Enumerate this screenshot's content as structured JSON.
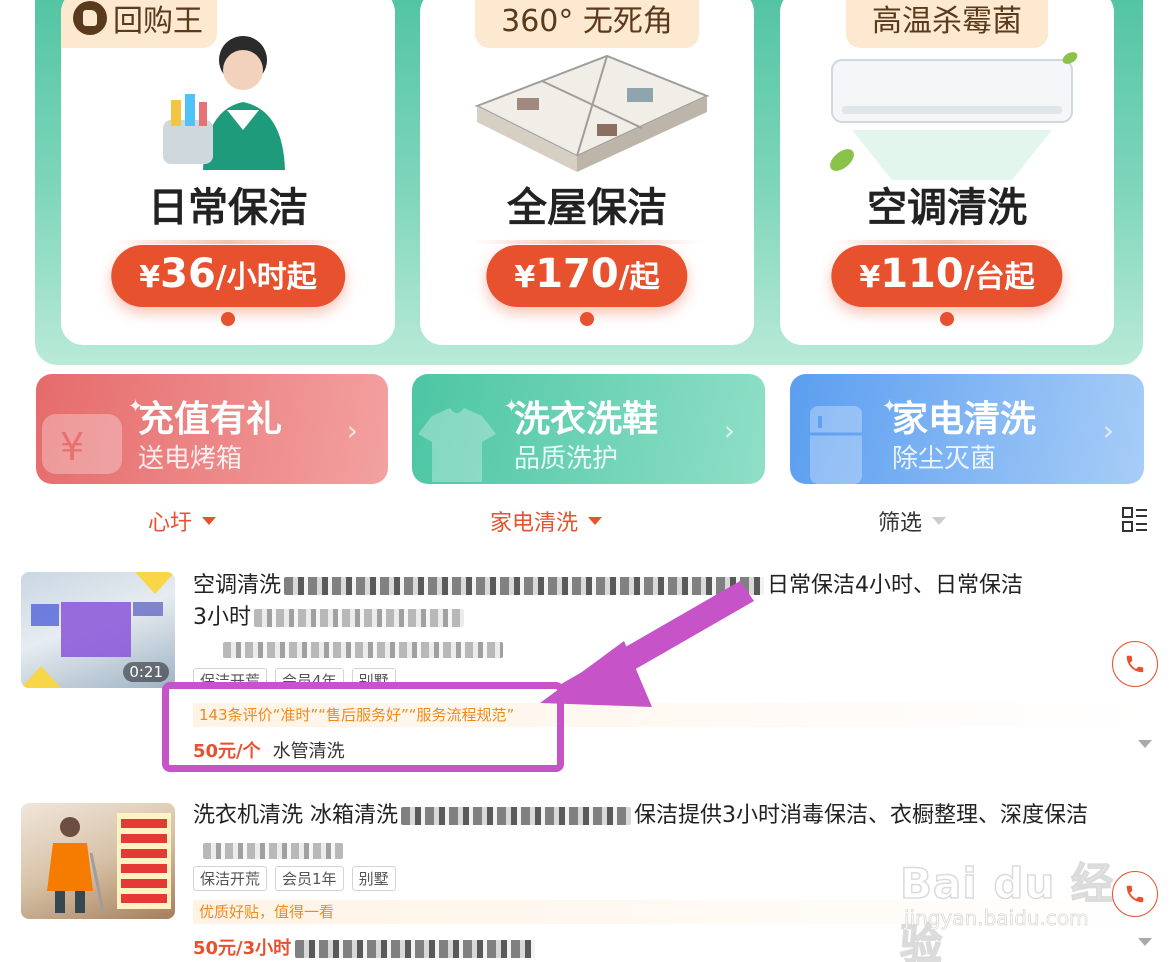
{
  "service_cards": [
    {
      "tag": "回购王",
      "title": "日常保洁",
      "price_symbol": "¥",
      "price_amount": "36",
      "price_unit": "/小时起"
    },
    {
      "tag": "360° 无死角",
      "title": "全屋保洁",
      "price_symbol": "¥",
      "price_amount": "170",
      "price_unit": "/起"
    },
    {
      "tag": "高温杀霉菌",
      "title": "空调清洗",
      "price_symbol": "¥",
      "price_amount": "110",
      "price_unit": "/台起"
    }
  ],
  "category_tiles": [
    {
      "title": "充值有礼",
      "subtitle": "送电烤箱",
      "color": "#e66b6b"
    },
    {
      "title": "洗衣洗鞋",
      "subtitle": "品质洗护",
      "color": "#4cc6a4"
    },
    {
      "title": "家电清洗",
      "subtitle": "除尘灭菌",
      "color": "#5b9ef0"
    }
  ],
  "filters": [
    {
      "label": "心圩",
      "active": true
    },
    {
      "label": "家电清洗",
      "active": true
    },
    {
      "label": "筛选",
      "active": false
    }
  ],
  "listings": [
    {
      "title_start": "空调清洗",
      "title_end": "日常保洁4小时、日常保洁",
      "title_line2_start": "3小时",
      "video_duration": "0:21",
      "tags": [
        "保洁开荒",
        "会员4年",
        "别墅"
      ],
      "review": "143条评价“准时”“售后服务好”“服务流程规范”",
      "price": "50元/个",
      "service": "水管清洗"
    },
    {
      "title_start": "洗衣机清洗",
      "title_mid": "冰箱清洗",
      "title_end": "保洁提供3小时消毒保洁、衣橱整理、深度保洁",
      "tags": [
        "保洁开荒",
        "会员1年",
        "别墅"
      ],
      "review": "优质好贴，值得一看",
      "price": "50元/3小时"
    }
  ],
  "watermark": {
    "main": "Bai du 经验",
    "sub": "jingyan.baidu.com"
  },
  "colors": {
    "accent": "#e8512d",
    "annotation": "#c653c8",
    "banner": "#4fc3a1"
  }
}
